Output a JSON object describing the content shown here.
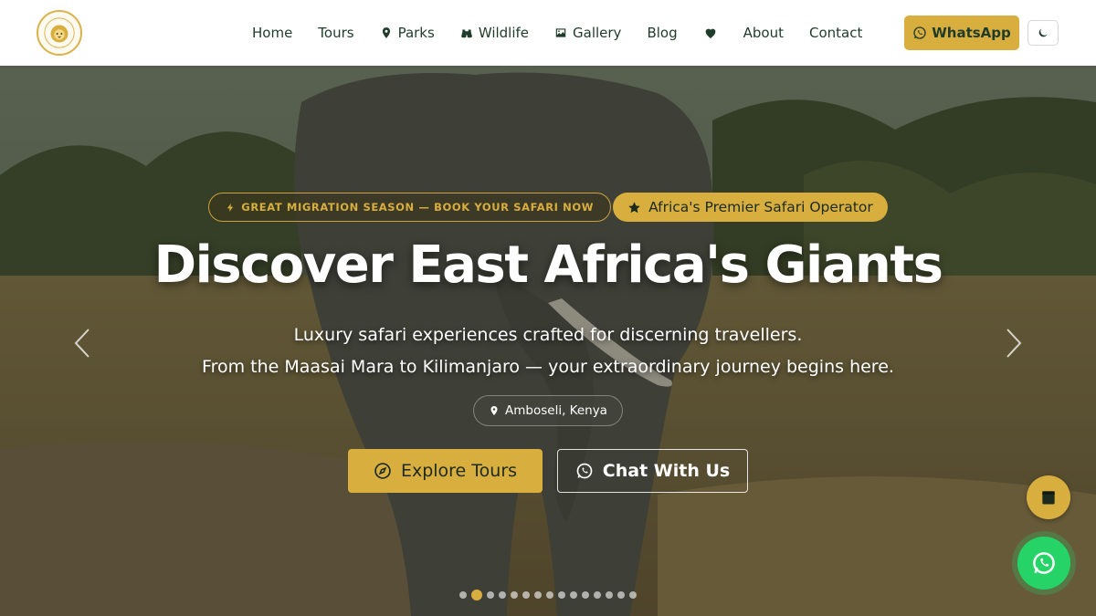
{
  "nav": {
    "logo_icon": "lion-logo",
    "items": [
      {
        "label": "Home",
        "icon": ""
      },
      {
        "label": "Tours",
        "icon": ""
      },
      {
        "label": "Parks",
        "icon": "map-pin-icon"
      },
      {
        "label": "Wildlife",
        "icon": "binoculars-icon"
      },
      {
        "label": "Gallery",
        "icon": "image-icon"
      },
      {
        "label": "Blog",
        "icon": ""
      },
      {
        "label": "About",
        "icon": ""
      },
      {
        "label": "Contact",
        "icon": ""
      }
    ],
    "whatsapp_label": "WhatsApp",
    "dark_mode_icon": "moon-icon"
  },
  "hero": {
    "migration_badge": "GREAT MIGRATION SEASON — BOOK YOUR SAFARI NOW",
    "premier_badge": "Africa's Premier Safari Operator",
    "title": "Discover East Africa's Giants",
    "subtitle_line1": "Luxury safari experiences crafted for discerning travellers.",
    "subtitle_line2": "From the Maasai Mara to Kilimanjaro — your extraordinary journey begins here.",
    "location": "Amboseli, Kenya",
    "explore_label": "Explore Tours",
    "chat_label": "Chat With Us",
    "slide_count": 15,
    "active_slide": 2
  },
  "colors": {
    "accent_gold": "#d8ae3e",
    "nav_text": "#1f3b2a",
    "whatsapp_green": "#25d366"
  }
}
